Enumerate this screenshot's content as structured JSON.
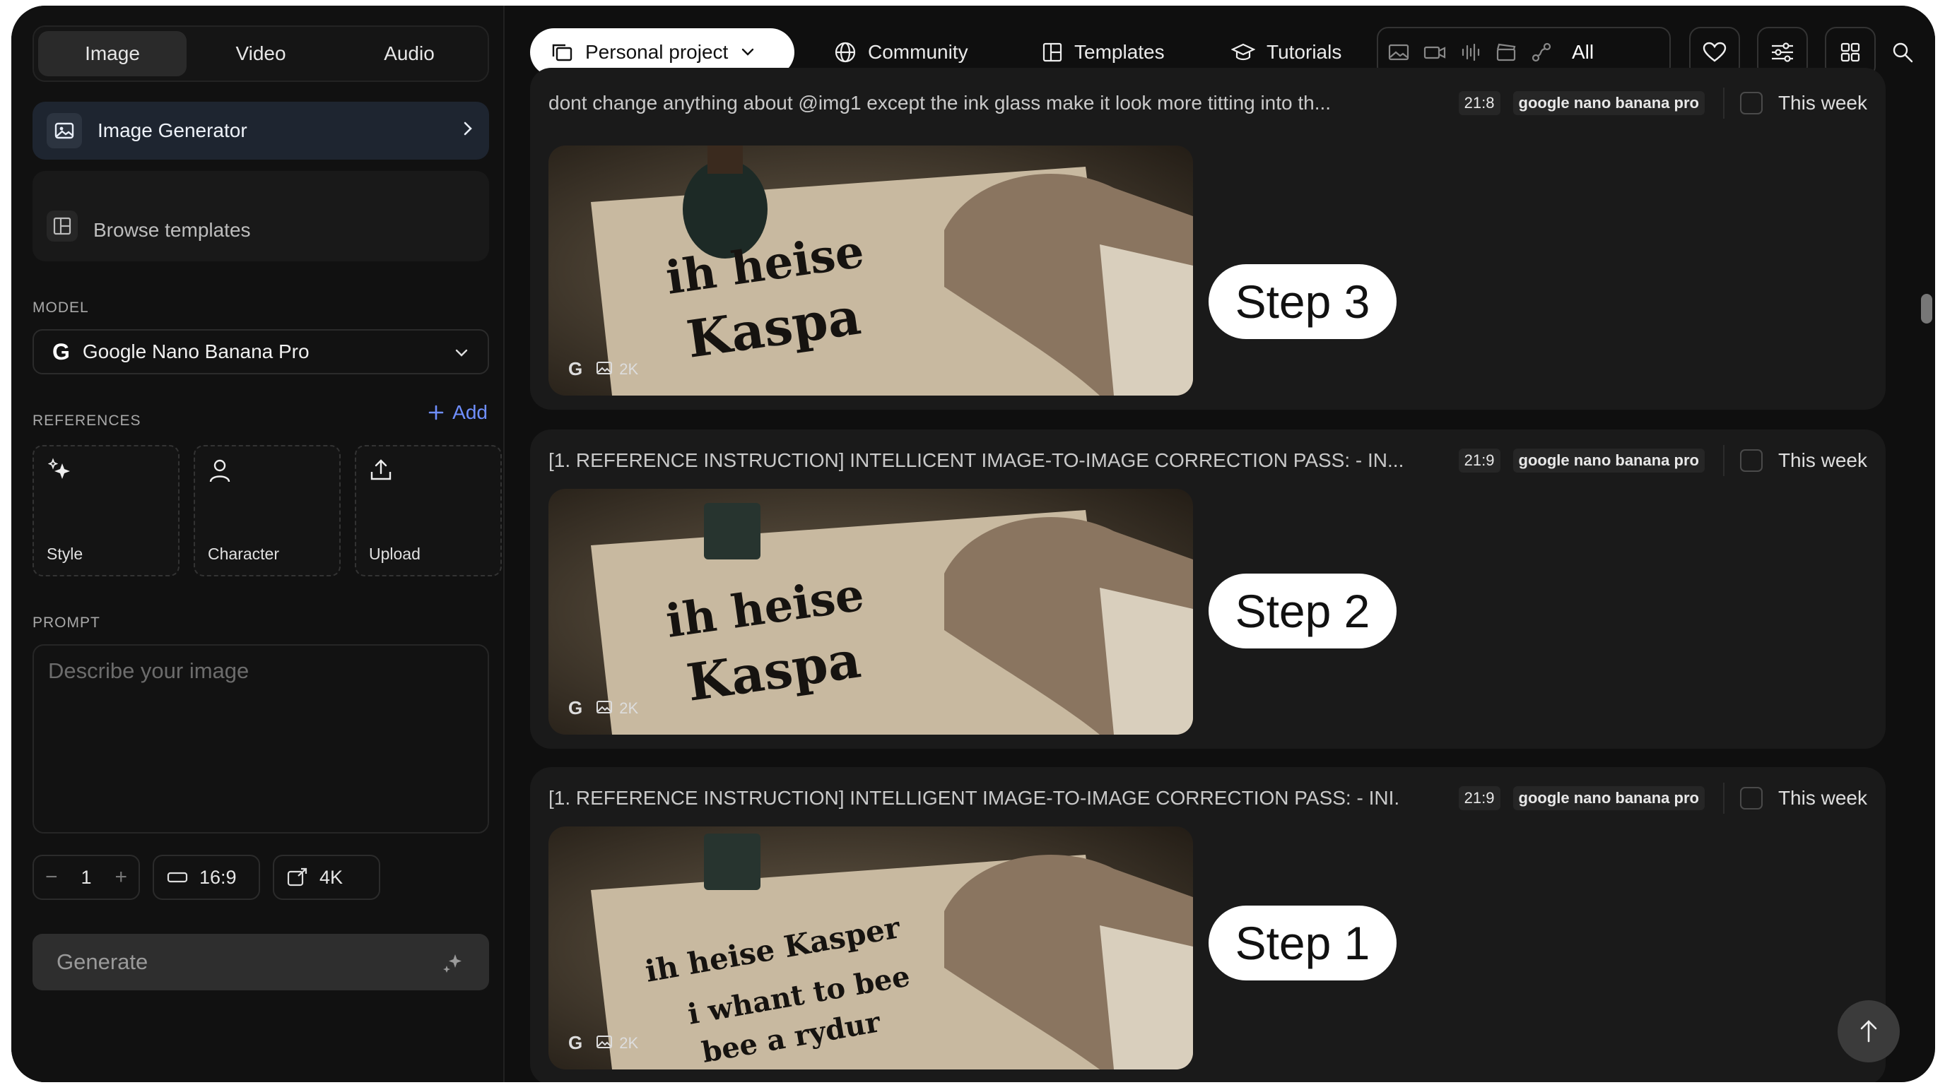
{
  "sidebar": {
    "tabs": [
      {
        "label": "Image",
        "active": true
      },
      {
        "label": "Video",
        "active": false
      },
      {
        "label": "Audio",
        "active": false
      }
    ],
    "image_generator_label": "Image Generator",
    "browse_templates_label": "Browse templates",
    "model_section_label": "MODEL",
    "model_selected": "Google Nano Banana Pro",
    "references_section_label": "REFERENCES",
    "add_label": "Add",
    "references": [
      {
        "label": "Style",
        "icon": "magic-stars-icon"
      },
      {
        "label": "Character",
        "icon": "person-icon"
      },
      {
        "label": "Upload",
        "icon": "upload-icon"
      }
    ],
    "prompt_section_label": "PROMPT",
    "prompt_placeholder": "Describe your image",
    "count_value": "1",
    "aspect_ratio": "16:9",
    "resolution": "4K",
    "generate_label": "Generate"
  },
  "topbar": {
    "project_label": "Personal project",
    "nav": [
      {
        "label": "Community",
        "icon": "globe-icon"
      },
      {
        "label": "Templates",
        "icon": "templates-icon"
      },
      {
        "label": "Tutorials",
        "icon": "graduation-cap-icon"
      }
    ],
    "filter_all_label": "All"
  },
  "feed": [
    {
      "prompt": "dont change anything about @img1 except the ink glass make it look more titting into th...",
      "ratio": "21:8",
      "model": "google nano banana pro",
      "date_filter": "This week",
      "resolution": "2K",
      "step_label": "Step 3",
      "image_text": [
        "ih heise",
        "Kaspa"
      ]
    },
    {
      "prompt": "[1. REFERENCE INSTRUCTION] INTELLICENT IMAGE-TO-IMAGE CORRECTION PASS: - IN...",
      "ratio": "21:9",
      "model": "google nano banana pro",
      "date_filter": "This week",
      "resolution": "2K",
      "step_label": "Step 2",
      "image_text": [
        "ih heise",
        "Kaspa"
      ]
    },
    {
      "prompt": "[1. REFERENCE INSTRUCTION] INTELLIGENT IMAGE-TO-IMAGE CORRECTION PASS: - INI.",
      "ratio": "21:9",
      "model": "google nano banana pro",
      "date_filter": "This week",
      "resolution": "2K",
      "step_label": "Step 1",
      "image_text": [
        "ih heise Kasper",
        "i whant to bee",
        "bee a rydur"
      ]
    }
  ],
  "colors": {
    "background": "#0f0f0f",
    "sidebar": "#111111",
    "accent_link": "#6f8fff",
    "card_selected": "#1e2530",
    "pill_white": "#ffffff"
  }
}
